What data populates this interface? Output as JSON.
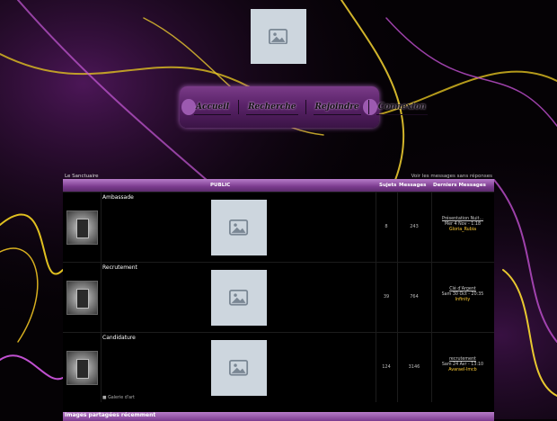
{
  "nav": {
    "items": [
      "Accueil",
      "Recherche",
      "Rejoindre",
      "Connexion"
    ]
  },
  "breadcrumb": "Le Sanctuaire",
  "view_link": "Voir les messages sans réponses",
  "table": {
    "headers": {
      "category": "PUBLIC",
      "topics": "Sujets",
      "posts": "Messages",
      "last": "Derniers Messages"
    }
  },
  "forums": [
    {
      "name": "Ambassade",
      "topics": "8",
      "posts": "243",
      "last_title": "Présentation Nuit...",
      "last_date": "Mer 4 Nov - 1:18",
      "last_user": "Gloria_Rubia"
    },
    {
      "name": "Recrutement",
      "topics": "39",
      "posts": "764",
      "last_title": "Clé d'Argent",
      "last_date": "Sam 30 Oct - 20:35",
      "last_user": "Infinity"
    },
    {
      "name": "Candidature",
      "topics": "124",
      "posts": "3146",
      "last_title": "recrutement",
      "last_date": "Sam 24 Avr - 13:10",
      "last_user": "Avarael-lmcb",
      "subforum": "Galerie d'art"
    }
  ],
  "footer_title": "Images partagées récemment",
  "colors": {
    "accent": "#7b3b8f",
    "highlight": "#ffcc33"
  }
}
